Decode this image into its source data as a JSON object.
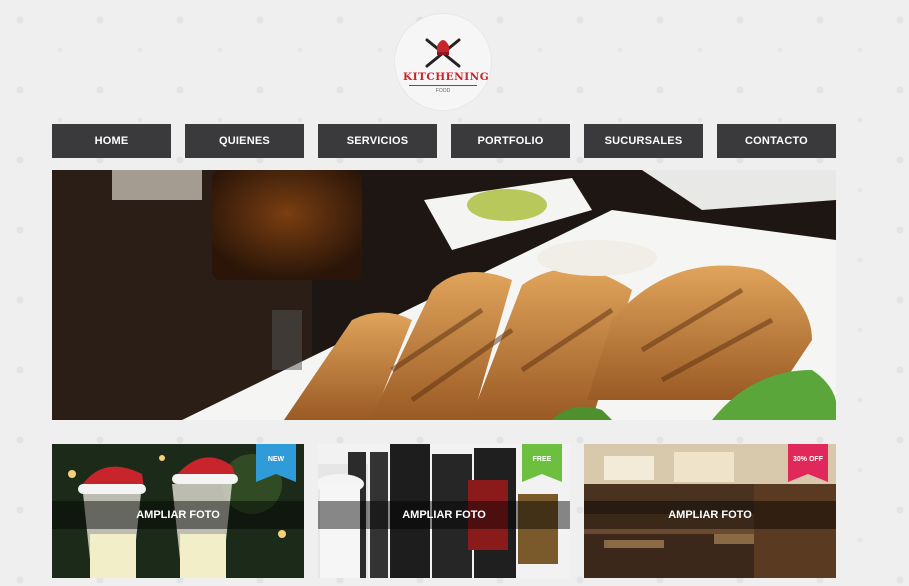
{
  "logo": {
    "brand": "KITCHENING",
    "tagline": "FOOD",
    "color": "#c8242b"
  },
  "nav": {
    "items": [
      {
        "label": "HOME"
      },
      {
        "label": "QUIENES"
      },
      {
        "label": "SERVICIOS"
      },
      {
        "label": "PORTFOLIO"
      },
      {
        "label": "SUCURSALES"
      },
      {
        "label": "CONTACTO"
      }
    ],
    "background": "#3a3a3c"
  },
  "hero": {
    "subject": "plated grilled stuffed flatbread with salad and beer"
  },
  "gallery": {
    "items": [
      {
        "overlay_label": "AMPLIAR FOTO",
        "ribbon_label": "NEW",
        "ribbon_color": "#2f9bd8"
      },
      {
        "overlay_label": "AMPLIAR FOTO",
        "ribbon_label": "FREE",
        "ribbon_color": "#6cbf3f"
      },
      {
        "overlay_label": "AMPLIAR FOTO",
        "ribbon_label": "30% OFF",
        "ribbon_color": "#e0285a"
      }
    ]
  }
}
